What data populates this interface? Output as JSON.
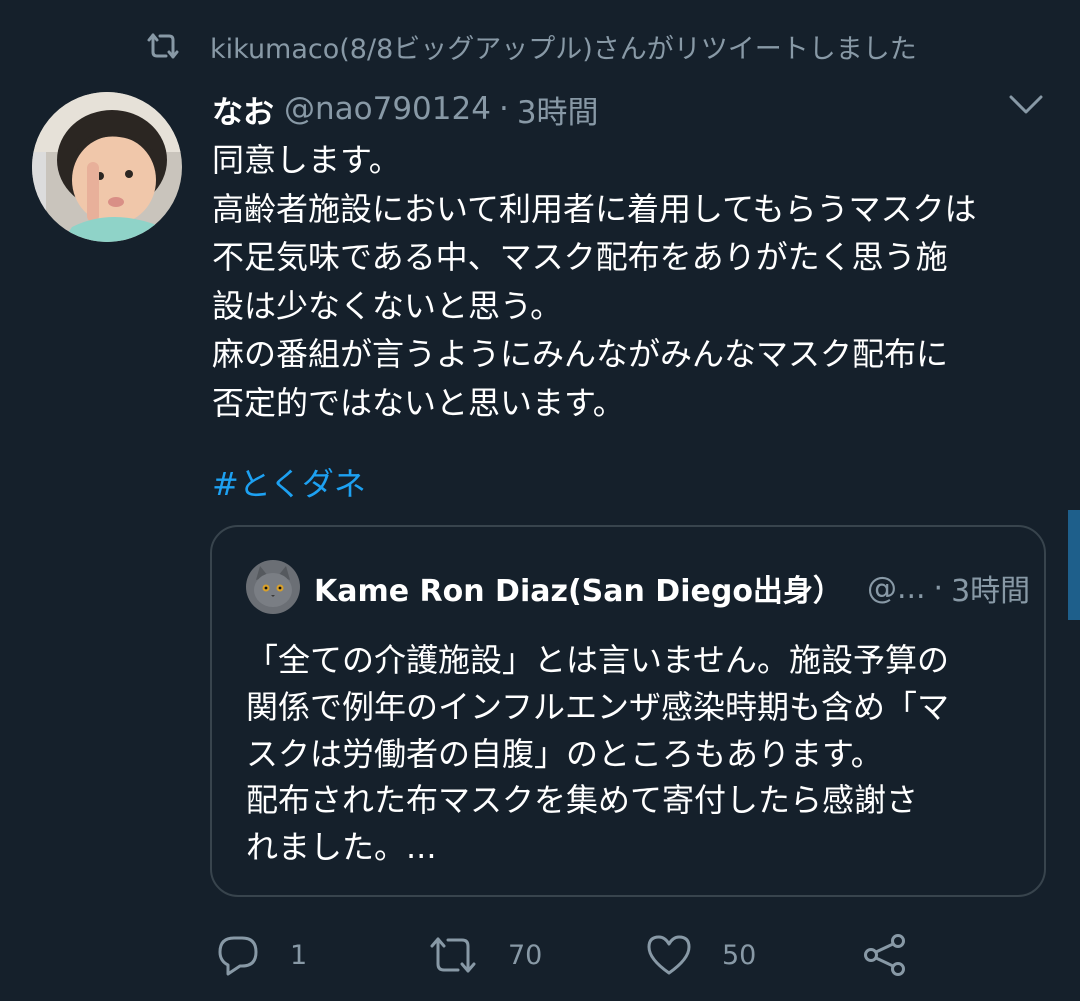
{
  "retweet_banner": {
    "icon": "retweet-icon",
    "text": "kikumaco(8/8ビッグアップル)さんがリツイートしました"
  },
  "tweet": {
    "avatar_icon": "user-avatar",
    "name": "なお",
    "handle": "@nao790124",
    "separator": "·",
    "time": "3時間",
    "caret_icon": "chevron-down-icon",
    "text_lines": [
      "同意します。",
      "高齢者施設において利用者に着用してもらうマスクは",
      "不足気味である中、マスク配布をありがたく思う施",
      "設は少なくないと思う。",
      "麻の番組が言うようにみんながみんなマスク配布に",
      "否定的ではないと思います。"
    ],
    "hashtag": "#とくダネ"
  },
  "quote": {
    "avatar_icon": "cat-avatar",
    "name": "Kame Ron Diaz(San Diego出身）",
    "handle": "@...",
    "separator": "·",
    "time": "3時間",
    "text_lines": [
      "「全ての介護施設」とは言いません。施設予算の",
      "関係で例年のインフルエンザ感染時期も含め「マ",
      "スクは労働者の自腹」のところもあります。",
      "配布された布マスクを集めて寄付したら感謝さ",
      "れました。..."
    ]
  },
  "actions": {
    "reply": {
      "icon": "reply-icon",
      "count": "1"
    },
    "retweet": {
      "icon": "retweet-icon",
      "count": "70"
    },
    "like": {
      "icon": "heart-icon",
      "count": "50"
    },
    "share": {
      "icon": "share-icon"
    }
  },
  "colors": {
    "background": "#15202b",
    "secondary_text": "#8899a6",
    "link": "#1da1f2",
    "border": "#38444d"
  }
}
